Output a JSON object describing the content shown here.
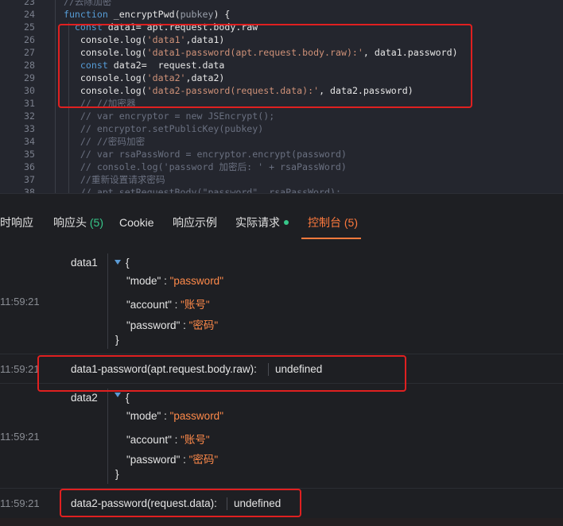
{
  "editor": {
    "lines": [
      {
        "n": "23",
        "parts": [
          {
            "t": "  //去除加密",
            "c": "com"
          }
        ]
      },
      {
        "n": "24",
        "parts": [
          {
            "t": "  function",
            "c": "kw"
          },
          {
            "t": " _encryptPwd(",
            "c": "fn"
          },
          {
            "t": "pubkey",
            "c": "param"
          },
          {
            "t": ") {",
            "c": "txt"
          }
        ]
      },
      {
        "n": "25",
        "parts": [
          {
            "t": "    const",
            "c": "kw"
          },
          {
            "t": " data1= apt.request.body.raw",
            "c": "txt"
          }
        ]
      },
      {
        "n": "26",
        "parts": [
          {
            "t": "     console.log(",
            "c": "txt"
          },
          {
            "t": "'data1'",
            "c": "str"
          },
          {
            "t": ",data1)",
            "c": "txt"
          }
        ]
      },
      {
        "n": "27",
        "parts": [
          {
            "t": "     console.log(",
            "c": "txt"
          },
          {
            "t": "'data1-password(apt.request.body.raw):'",
            "c": "str"
          },
          {
            "t": ", data1.password)",
            "c": "txt"
          }
        ]
      },
      {
        "n": "28",
        "parts": [
          {
            "t": "     const",
            "c": "kw"
          },
          {
            "t": " data2=  request.data",
            "c": "txt"
          }
        ]
      },
      {
        "n": "29",
        "parts": [
          {
            "t": "     console.log(",
            "c": "txt"
          },
          {
            "t": "'data2'",
            "c": "str"
          },
          {
            "t": ",data2)",
            "c": "txt"
          }
        ]
      },
      {
        "n": "30",
        "parts": [
          {
            "t": "     console.log(",
            "c": "txt"
          },
          {
            "t": "'data2-password(request.data):'",
            "c": "str"
          },
          {
            "t": ", data2.password)",
            "c": "txt"
          }
        ]
      },
      {
        "n": "31",
        "parts": [
          {
            "t": "     // //加密器",
            "c": "com"
          }
        ]
      },
      {
        "n": "32",
        "parts": [
          {
            "t": "     // var encryptor = new JSEncrypt();",
            "c": "com"
          }
        ]
      },
      {
        "n": "33",
        "parts": [
          {
            "t": "     // encryptor.setPublicKey(pubkey)",
            "c": "com"
          }
        ]
      },
      {
        "n": "34",
        "parts": [
          {
            "t": "     // //密码加密",
            "c": "com"
          }
        ]
      },
      {
        "n": "35",
        "parts": [
          {
            "t": "     // var rsaPassWord = encryptor.encrypt(password)",
            "c": "com"
          }
        ]
      },
      {
        "n": "36",
        "parts": [
          {
            "t": "     // console.log('password 加密后: ' + rsaPassWord)",
            "c": "com"
          }
        ]
      },
      {
        "n": "37",
        "parts": [
          {
            "t": "     //重新设置请求密码",
            "c": "com"
          }
        ]
      },
      {
        "n": "38",
        "parts": [
          {
            "t": "     // apt.setRequestBody(\"password\", rsaPassWord);",
            "c": "com"
          }
        ]
      }
    ]
  },
  "tabs": {
    "items": [
      {
        "label": "时响应"
      },
      {
        "label": "响应头",
        "count": "(5)"
      },
      {
        "label": "Cookie"
      },
      {
        "label": "响应示例"
      },
      {
        "label": "实际请求"
      },
      {
        "label": "控制台",
        "count": "(5)"
      }
    ]
  },
  "console": {
    "entries": [
      {
        "time": "11:59:21",
        "label": "data1",
        "open": "{",
        "close": "}",
        "props": [
          {
            "key": "\"mode\"",
            "sep": " : ",
            "value": "\"password\""
          },
          {
            "key": "\"account\"",
            "sep": " : ",
            "value": "\"账号\""
          },
          {
            "key": "\"password\"",
            "sep": " : ",
            "value": "\"密码\""
          }
        ]
      },
      {
        "time": "11:59:21",
        "label": "data1-password(apt.request.body.raw):",
        "value": "undefined"
      },
      {
        "time": "11:59:21",
        "label": "data2",
        "open": "{",
        "close": "}",
        "props": [
          {
            "key": "\"mode\"",
            "sep": " : ",
            "value": "\"password\""
          },
          {
            "key": "\"account\"",
            "sep": " : ",
            "value": "\"账号\""
          },
          {
            "key": "\"password\"",
            "sep": " : ",
            "value": "\"密码\""
          }
        ]
      },
      {
        "time": "11:59:21",
        "label": "data2-password(request.data):",
        "value": "undefined"
      }
    ]
  },
  "colors": {
    "accent": "#ff7a3d",
    "count_green": "#37c88a",
    "annotation_red": "#e02020"
  }
}
